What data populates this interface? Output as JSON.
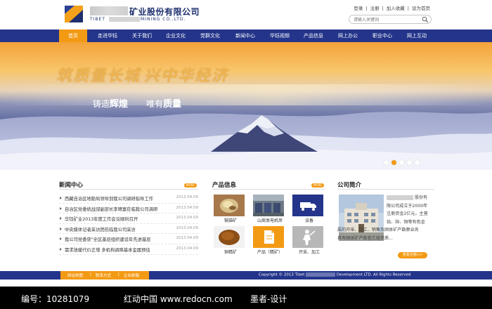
{
  "header": {
    "logo_cn": "矿业股份有限公司",
    "logo_en_left": "TIBET",
    "logo_en_right": "MINING CO.,LTD.",
    "top_links": [
      "登录",
      "|",
      "注册",
      "|",
      "加入收藏",
      "|",
      "设为首页"
    ],
    "search_placeholder": "请输入关键词"
  },
  "nav": {
    "items": [
      "首页",
      "走进华钰",
      "关于我们",
      "企业文化",
      "党群文化",
      "新闻中心",
      "华钰视频",
      "产品信息",
      "网上办公",
      "职业中心",
      "网上互动"
    ],
    "active_index": 0
  },
  "banner": {
    "slogan_part1": "筑质量长城",
    "slogan_part2": "兴中华经济",
    "sub1_prefix": "铸造",
    "sub1_bold": "辉煌",
    "sub2_prefix": "唯有",
    "sub2_bold": "质量",
    "dots": 5,
    "active_dot": 1
  },
  "news": {
    "title": "新闻中心",
    "more": "MORE",
    "items": [
      {
        "title": "西藏自治区地勘局领导到我公司调研指导工作",
        "date": "2013.04.09"
      },
      {
        "title": "自治区党委统战部副部长李晴富莅临我公司调研",
        "date": "2013.04.09"
      },
      {
        "title": "华钰矿业2013年度工作会议顺利召开",
        "date": "2013.04.09"
      },
      {
        "title": "中央媒体记者采访团莅临我公司采访",
        "date": "2013.04.09"
      },
      {
        "title": "我公司党委获\"全区基层组织建设年先进基层",
        "date": "2013.04.09"
      },
      {
        "title": "需求放缓代价正增 多机构调降基本金属预估",
        "date": "2013.04.09"
      }
    ]
  },
  "products": {
    "title": "产品信息",
    "more": "MORE",
    "items": [
      {
        "label": "锅锑矿",
        "icon": "ore-photo"
      },
      {
        "label": "山周发电机房",
        "icon": "machine-room-photo"
      },
      {
        "label": "设备",
        "icon": "truck-icon"
      },
      {
        "label": "铜精矿",
        "icon": "concentrate-photo"
      },
      {
        "label": "产品（精矿）",
        "icon": "document-icon"
      },
      {
        "label": "开采、加工",
        "icon": "worker-icon"
      }
    ]
  },
  "company": {
    "title": "公司简介",
    "lines": [
      "股份有",
      "限公司成立于2000年",
      "注册资金2亿元，主营",
      "铅、锌、铜等有色金",
      "属的开采、加工、销售及固体矿产勘察业务",
      "具有固体矿产勘查乙级资质..."
    ],
    "more_button": "查看全部>>"
  },
  "footer": {
    "links": [
      "网站地图",
      "|",
      "联系方式",
      "|",
      "企业邮箱"
    ],
    "copyright_prefix": "Copyright © 2013 Tibet",
    "copyright_suffix": "Development LTD.  All Rights Reserved"
  },
  "watermark": {
    "id_text": "编号：10281079",
    "site_text": "红动中国 www.redocn.com",
    "author_text": "墨者-设计"
  },
  "colors": {
    "nav_blue": "#23348a",
    "accent_orange": "#f39a14"
  }
}
